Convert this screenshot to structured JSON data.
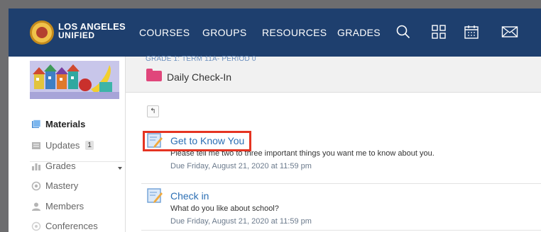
{
  "brand": {
    "line1": "LOS ANGELES",
    "line2": "UNIFIED",
    "logo_icon": "district-seal-icon"
  },
  "nav": {
    "links": [
      "COURSES",
      "GROUPS",
      "RESOURCES",
      "GRADES"
    ],
    "icons": [
      "search-icon",
      "apps-grid-icon",
      "calendar-icon",
      "mail-icon"
    ]
  },
  "sidebar": {
    "items": [
      {
        "label": "Materials",
        "icon": "materials-icon",
        "active": true
      },
      {
        "label": "Updates",
        "icon": "updates-icon",
        "badge": "1"
      },
      {
        "label": "Grades",
        "icon": "grades-icon"
      },
      {
        "label": "Mastery",
        "icon": "mastery-icon"
      },
      {
        "label": "Members",
        "icon": "members-icon"
      },
      {
        "label": "Conferences",
        "icon": "conferences-icon"
      }
    ]
  },
  "header": {
    "breadcrumb": "GRADE 1: TERM 11A- PERIOD 0",
    "title": "Daily Check-In"
  },
  "back_button": {
    "label": "↰"
  },
  "assignments": [
    {
      "title": "Get to Know You",
      "description": "Please tell me two to three important things you want me to know about you.",
      "due": "Due Friday, August 21, 2020 at 11:59 pm"
    },
    {
      "title": "Check in",
      "description": "What do you like about school?",
      "due": "Due Friday, August 21, 2020 at 11:59 pm"
    }
  ],
  "colors": {
    "nav_bg": "#1e3f6e",
    "link": "#2c6fb4",
    "highlight": "#e53422",
    "folder": "#e0467b"
  }
}
